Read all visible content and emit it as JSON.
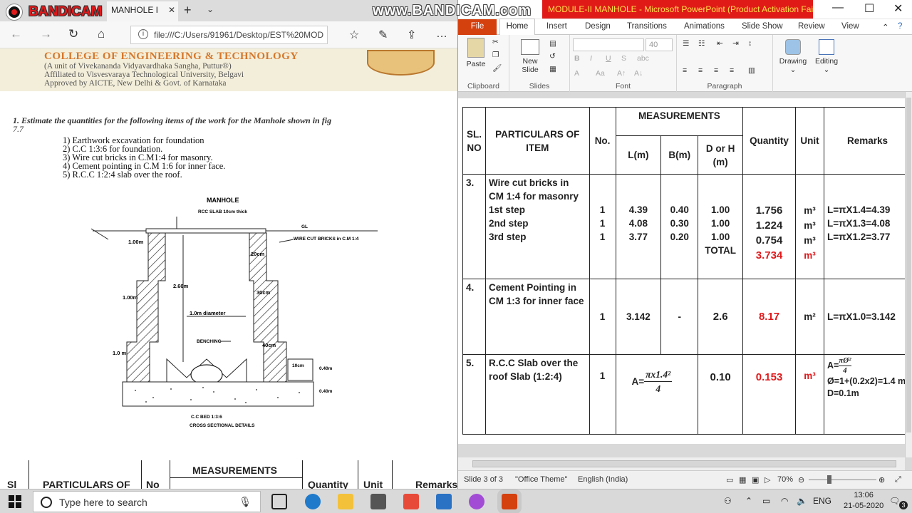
{
  "browser": {
    "tab_title": "MANHOLE I",
    "address": "file:///C:/Users/91961/Desktop/EST%20MOD",
    "recorder_name": "BANDICAM",
    "watermark": "www.BANDICAM.com",
    "pdf": {
      "college_name": "COLLEGE OF ENGINEERING & TECHNOLOGY",
      "college_lines": [
        "(A unit of Vivekananda Vidyavardhaka Sangha, Puttur®)",
        "Affiliated to Visvesvaraya Technological University, Belgavi",
        "Approved by AICTE, New Delhi & Govt. of Karnataka"
      ],
      "question": "1. Estimate the quantities for the following items of the work for the Manhole shown in fig",
      "question_num": "7.7",
      "items": [
        "1)  Earthwork excavation for foundation",
        "2)  C.C 1:3:6 for foundation.",
        "3)  Wire cut bricks in C.M1:4 for masonry.",
        "4)  Cement pointing in C.M 1:6 for inner face.",
        "5)  R.C.C 1:2:4 slab over the roof."
      ],
      "drawing": {
        "title": "MANHOLE",
        "rcc": "RCC SLAB 10cm thick",
        "gl": "GL",
        "wire": "WIRE CUT BRICKS in C.M 1:4",
        "d1": "1.00m",
        "d2": "1.00m",
        "d3": "1.0 m",
        "h": "2.60m",
        "dia": "1.0m diameter",
        "benching": "BENCHING",
        "w20": "20cm",
        "w30": "30cm",
        "w40": "40cm",
        "t10": "10cm",
        "d040a": "0.40m",
        "d040b": "0.40m",
        "bed": "C.C BED 1:3:6",
        "section": "CROSS SECTIONAL DETAILS"
      },
      "table_header": {
        "sl": "Sl",
        "particulars": "PARTICULARS OF",
        "no": "No",
        "measurements": "MEASUREMENTS",
        "quantity": "Quantity",
        "unit": "Unit",
        "remarks": "Remarks"
      }
    }
  },
  "ppt": {
    "title": "MODULE-II MANHOLE  -  Microsoft PowerPoint (Product Activation Faile...",
    "tabs": [
      "File",
      "Home",
      "Insert",
      "Design",
      "Transitions",
      "Animations",
      "Slide Show",
      "Review",
      "View"
    ],
    "ribbon": {
      "paste": "Paste",
      "new_slide": "New Slide",
      "font_size": "40",
      "drawing": "Drawing",
      "editing": "Editing",
      "groups": [
        "Clipboard",
        "Slides",
        "Font",
        "Paragraph"
      ]
    },
    "status": {
      "slide": "Slide 3 of 3",
      "theme": "\"Office Theme\"",
      "language": "English (India)",
      "zoom": "70%"
    },
    "table": {
      "headers": {
        "sl": "SL. NO",
        "particulars": "PARTICULARS OF ITEM",
        "no": "No.",
        "measurements": "MEASUREMENTS",
        "l": "L(m)",
        "b": "B(m)",
        "d": "D or H (m)",
        "quantity": "Quantity",
        "unit": "Unit",
        "remarks": "Remarks"
      },
      "row3": {
        "sl": "3.",
        "item": "Wire cut bricks in CM 1:4 for masonry",
        "steps": [
          "1st step",
          "2nd step",
          "3rd step"
        ],
        "nos": [
          "1",
          "1",
          "1"
        ],
        "l": [
          "4.39",
          "4.08",
          "3.77"
        ],
        "b": [
          "0.40",
          "0.30",
          "0.20"
        ],
        "d": [
          "1.00",
          "1.00",
          "1.00"
        ],
        "total_label": "TOTAL",
        "qty": [
          "1.756",
          "1.224",
          "0.754"
        ],
        "total_qty": "3.734",
        "unit": "m³",
        "remarks": [
          "L=πX1.4=4.39",
          "L=πX1.3=4.08",
          "L=πX1.2=3.77"
        ]
      },
      "row4": {
        "sl": "4.",
        "item": "Cement Pointing in CM 1:3 for inner face",
        "no": "1",
        "l": "3.142",
        "b": "-",
        "d": "2.6",
        "qty": "8.17",
        "unit": "m²",
        "remarks": "L=πX1.0=3.142"
      },
      "row5": {
        "sl": "5.",
        "item": "R.C.C Slab over the roof Slab (1:2:4)",
        "no": "1",
        "area_prefix": "A=",
        "area_num": "πx1.4²",
        "area_den": "4",
        "d": "0.10",
        "qty": "0.153",
        "unit": "m³",
        "remarks_a": "A=",
        "remarks_num": "πØ²",
        "remarks_den": "4",
        "remarks_phi": "Ø=1+(0.2x2)=1.4 m",
        "remarks_d": "D=0.1m"
      }
    }
  },
  "taskbar": {
    "search_placeholder": "Type here to search",
    "lang": "ENG",
    "time": "13:06",
    "date": "21-05-2020",
    "notif_count": "3"
  },
  "colors": {
    "accent_red": "#e0191b",
    "file_tab": "#d5400f",
    "college": "#d6772a"
  }
}
